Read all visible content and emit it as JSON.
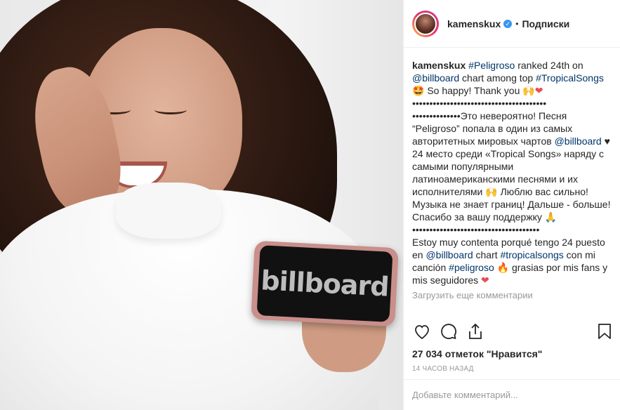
{
  "post": {
    "photo_text": "billboard"
  },
  "header": {
    "username": "kamenskux",
    "verified_glyph": "✓",
    "separator": "•",
    "follow_label": "Подписки"
  },
  "caption": {
    "author": "kamenskux",
    "line1_tag": "#Peligroso",
    "line1_text": " ranked 24th on",
    "line2_mention": "@billboard",
    "line2_text": " chart among top ",
    "line2_tag": "#TropicalSongs",
    "line3_emoji": "🤩",
    "line3_text": " So happy! Thank you ",
    "line3_emoji2": "🙌",
    "line3_heart": "❤",
    "dots1": "•••••••••••••••••••••••••••••••••••••••",
    "ru_start": "••••••••••••••Это невероятно! Песня “Peligroso” попала в один из самых авторитетных мировых чартов ",
    "ru_mention": "@billboard",
    "ru_heart": "♥",
    "ru_mid": " 24 место среди «Tropical Songs» наряду с самыми популярными латиноамериканскими песнями и их исполнителями ",
    "ru_emoji": "🙌",
    "ru_end": " Люблю вас сильно! Музыка не знает границ! Дальше - больше! Спасибо за вашу поддержку",
    "ru_pray": "🙏",
    "dots2": "•••••••••••••••••••••••••••••••••••••",
    "es_start": "Estoy muy contenta porqué tengo 24 puesto en ",
    "es_mention": "@billboard",
    "es_mid": " chart ",
    "es_tag1": "#tropicalsongs",
    "es_mid2": " con mi canción ",
    "es_tag2": "#peligroso",
    "es_fire": "🔥",
    "es_end": " grasias por mis fans y mis seguidores ",
    "es_heart": "❤",
    "load_more": "Загрузить еще комментарии"
  },
  "stats": {
    "likes": "27 034 отметок \"Нравится\"",
    "time": "14 ЧАСОВ НАЗАД"
  },
  "comment": {
    "placeholder": "Добавьте комментарий..."
  }
}
